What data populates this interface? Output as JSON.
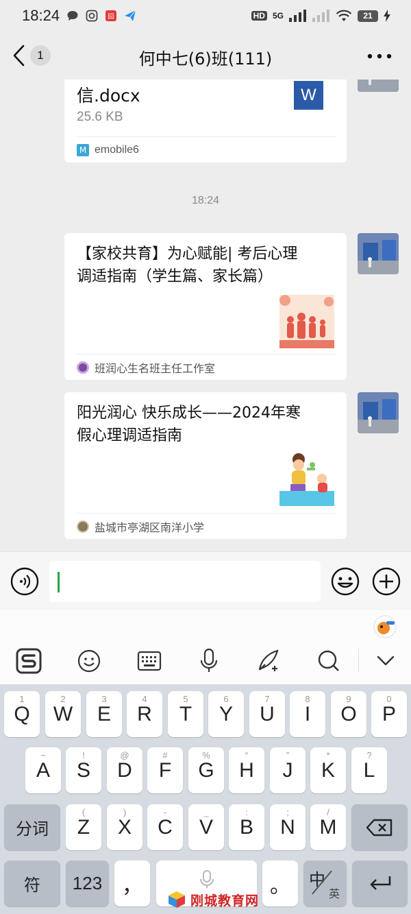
{
  "status_bar": {
    "time": "18:24",
    "signal": "5G",
    "battery": "21",
    "hd": "HD"
  },
  "nav": {
    "back_count": "1",
    "title": "何中七(6)班(111)"
  },
  "chat": {
    "file_card": {
      "name_tail": "信.docx",
      "size": "25.6 KB",
      "file_badge": "W",
      "source": "emobile6"
    },
    "time_label": "18:24",
    "article1": {
      "title_line1": "【家校共育】为心赋能| 考后心理",
      "title_line2": "调适指南（学生篇、家长篇）",
      "source": "班润心生名班主任工作室"
    },
    "article2": {
      "title_line1": "阳光润心 快乐成长——2024年寒",
      "title_line2": "假心理调适指南",
      "source": "盐城市亭湖区南洋小学"
    }
  },
  "keyboard": {
    "row1": [
      {
        "main": "Q",
        "sub": "1"
      },
      {
        "main": "W",
        "sub": "2"
      },
      {
        "main": "E",
        "sub": "3"
      },
      {
        "main": "R",
        "sub": "4"
      },
      {
        "main": "T",
        "sub": "5"
      },
      {
        "main": "Y",
        "sub": "6"
      },
      {
        "main": "U",
        "sub": "7"
      },
      {
        "main": "I",
        "sub": "8"
      },
      {
        "main": "O",
        "sub": "9"
      },
      {
        "main": "P",
        "sub": "0"
      }
    ],
    "row2": [
      {
        "main": "A",
        "sub": "~"
      },
      {
        "main": "S",
        "sub": "!"
      },
      {
        "main": "D",
        "sub": "@"
      },
      {
        "main": "F",
        "sub": "#"
      },
      {
        "main": "G",
        "sub": "%"
      },
      {
        "main": "H",
        "sub": "“"
      },
      {
        "main": "J",
        "sub": "”"
      },
      {
        "main": "K",
        "sub": "*"
      },
      {
        "main": "L",
        "sub": "?"
      }
    ],
    "row3": [
      {
        "main": "Z",
        "sub": "("
      },
      {
        "main": "X",
        "sub": ")"
      },
      {
        "main": "C",
        "sub": "-"
      },
      {
        "main": "V",
        "sub": "_"
      },
      {
        "main": "B",
        "sub": ":"
      },
      {
        "main": "N",
        "sub": ";"
      },
      {
        "main": "M",
        "sub": "/"
      }
    ],
    "segment_key": "分词",
    "symbol_key": "符",
    "num_key": "123",
    "comma_key": "，",
    "period_key": "。",
    "lang_key_main": "中",
    "lang_key_sub": "英"
  },
  "watermark": {
    "text": "刚城教育网"
  }
}
